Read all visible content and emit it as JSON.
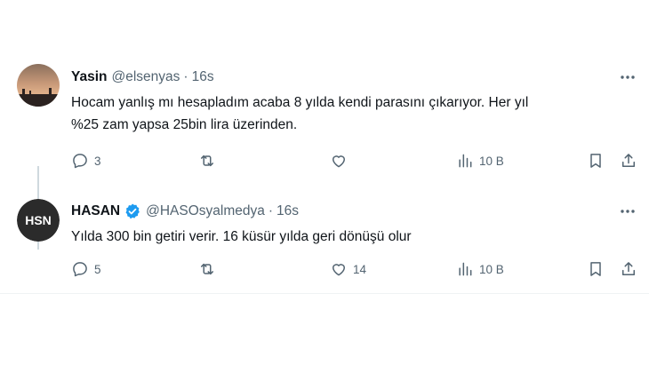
{
  "tweets": [
    {
      "name": "Yasin",
      "handle": "@elsenyas",
      "separator": "·",
      "time": "16s",
      "text_line1": "Hocam yanlış mı hesapladım acaba 8 yılda kendi parasını çıkarıyor. Her yıl",
      "text_line2": "%25 zam yapsa 25bin lira üzerinden.",
      "replies": "3",
      "retweets": "",
      "likes": "",
      "views": "10 B"
    },
    {
      "name": "HASAN",
      "handle": "@HASOsyalmedya",
      "separator": "·",
      "time": "16s",
      "avatar_text": "HSN",
      "text_line1": "Yılda 300 bin getiri verir. 16 küsür yılda geri dönüşü olur",
      "replies": "5",
      "retweets": "",
      "likes": "14",
      "views": "10 B"
    }
  ],
  "colors": {
    "text": "#0f1419",
    "secondary": "#536471",
    "verified": "#1d9bf0",
    "thread_line": "#cfd9de"
  }
}
